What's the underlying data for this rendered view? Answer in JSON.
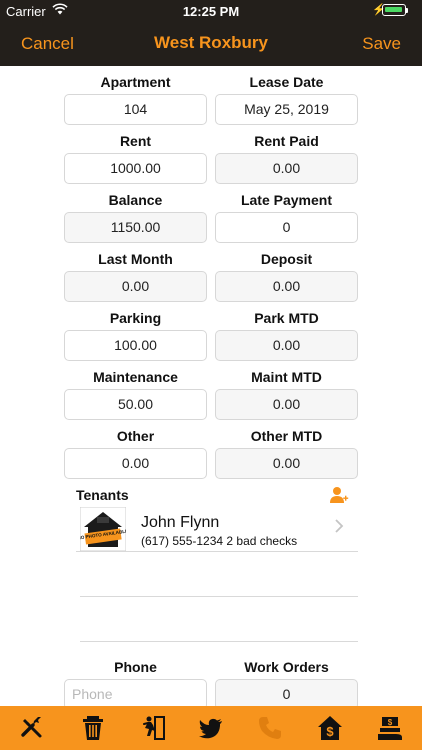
{
  "status_bar": {
    "carrier": "Carrier",
    "time": "12:25 PM"
  },
  "nav": {
    "cancel_label": "Cancel",
    "title": "West Roxbury",
    "save_label": "Save"
  },
  "fields": {
    "apartment": {
      "label": "Apartment",
      "value": "104"
    },
    "lease_date": {
      "label": "Lease Date",
      "value": "May 25, 2019"
    },
    "rent": {
      "label": "Rent",
      "value": "1000.00"
    },
    "rent_paid": {
      "label": "Rent Paid",
      "value": "0.00"
    },
    "balance": {
      "label": "Balance",
      "value": "1150.00"
    },
    "late_payment": {
      "label": "Late Payment",
      "value": "0"
    },
    "last_month": {
      "label": "Last Month",
      "value": "0.00"
    },
    "deposit": {
      "label": "Deposit",
      "value": "0.00"
    },
    "parking": {
      "label": "Parking",
      "value": "100.00"
    },
    "park_mtd": {
      "label": "Park MTD",
      "value": "0.00"
    },
    "maintenance": {
      "label": "Maintenance",
      "value": "50.00"
    },
    "maint_mtd": {
      "label": "Maint MTD",
      "value": "0.00"
    },
    "other": {
      "label": "Other",
      "value": "0.00"
    },
    "other_mtd": {
      "label": "Other MTD",
      "value": "0.00"
    },
    "phone": {
      "label": "Phone",
      "value": "",
      "placeholder": "Phone"
    },
    "work_orders": {
      "label": "Work Orders",
      "value": "0"
    }
  },
  "tenants": {
    "label": "Tenants",
    "items": [
      {
        "name": "John Flynn",
        "detail": "(617) 555-1234 2 bad checks",
        "avatar_text": "NO PHOTO AVAILABLE"
      }
    ]
  },
  "tabbar": {
    "icons": [
      "tools-icon",
      "trash-icon",
      "exit-icon",
      "twitter-icon",
      "phone-icon",
      "money-house-icon",
      "hand-money-icon"
    ]
  },
  "colors": {
    "accent": "#f7941d",
    "topbar": "#231f1b",
    "battery": "#4cd964"
  }
}
